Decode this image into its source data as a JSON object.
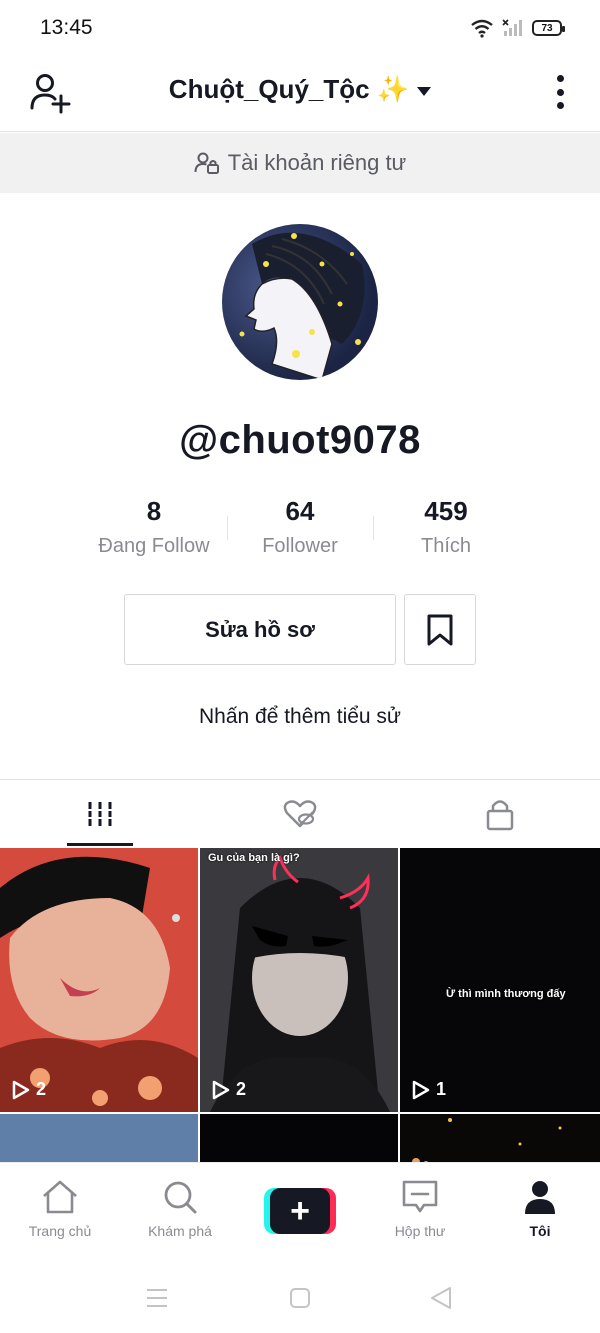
{
  "status_bar": {
    "time": "13:45",
    "battery": "73"
  },
  "header": {
    "username": "Chuột_Quý_Tộc",
    "emoji": "✨"
  },
  "private_banner": {
    "label": "Tài khoản riêng tư"
  },
  "profile": {
    "handle": "@chuot9078",
    "bio_placeholder": "Nhấn để thêm tiểu sử"
  },
  "stats": [
    {
      "value": "8",
      "label": "Đang Follow"
    },
    {
      "value": "64",
      "label": "Follower"
    },
    {
      "value": "459",
      "label": "Thích"
    }
  ],
  "buttons": {
    "edit_profile": "Sửa hồ sơ"
  },
  "videos": [
    {
      "views": "2",
      "caption": ""
    },
    {
      "views": "2",
      "caption": "Gu của bạn là gì?"
    },
    {
      "views": "1",
      "caption": "Ừ thì mình thương đấy"
    }
  ],
  "bottom_nav": [
    {
      "label": "Trang chủ",
      "icon": "home-icon"
    },
    {
      "label": "Khám phá",
      "icon": "search-icon"
    },
    {
      "label": "",
      "icon": "plus-icon"
    },
    {
      "label": "Hộp thư",
      "icon": "inbox-icon"
    },
    {
      "label": "Tôi",
      "icon": "profile-icon"
    }
  ],
  "colors": {
    "accent_pink": "#fe2c55",
    "accent_cyan": "#25f4ee",
    "text": "#161823",
    "muted": "#8a8b91"
  }
}
